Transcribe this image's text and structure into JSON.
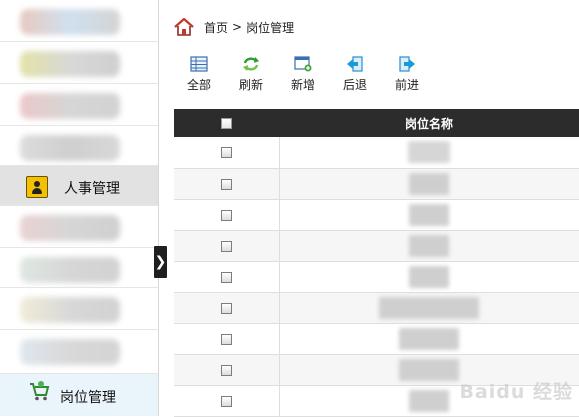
{
  "sidebar": {
    "items": [
      {
        "id": "blurred-1",
        "label": ""
      },
      {
        "id": "blurred-2",
        "label": ""
      },
      {
        "id": "blurred-3",
        "label": ""
      },
      {
        "id": "blurred-4",
        "label": ""
      },
      {
        "id": "hr",
        "label": "人事管理"
      },
      {
        "id": "blurred-5",
        "label": ""
      },
      {
        "id": "blurred-6",
        "label": ""
      },
      {
        "id": "blurred-7",
        "label": ""
      },
      {
        "id": "blurred-8",
        "label": ""
      },
      {
        "id": "position",
        "label": "岗位管理"
      }
    ],
    "toggle_glyph": "❯",
    "active_color": "#e2e2e2",
    "selected_color": "#eaf4fb"
  },
  "breadcrumb": {
    "home": "首页",
    "separator": ">",
    "current": "岗位管理"
  },
  "toolbar": {
    "buttons": [
      {
        "id": "all",
        "label": "全部",
        "icon": "grid-list-icon"
      },
      {
        "id": "refresh",
        "label": "刷新",
        "icon": "refresh-icon"
      },
      {
        "id": "add",
        "label": "新增",
        "icon": "add-window-icon"
      },
      {
        "id": "back",
        "label": "后退",
        "icon": "back-arrow-icon"
      },
      {
        "id": "forward",
        "label": "前进",
        "icon": "forward-arrow-icon"
      }
    ]
  },
  "grid": {
    "header": {
      "name_column": "岗位名称"
    },
    "header_color": "#2c2c2c",
    "rows": [
      {
        "name": ""
      },
      {
        "name": ""
      },
      {
        "name": ""
      },
      {
        "name": ""
      },
      {
        "name": ""
      },
      {
        "name": ""
      },
      {
        "name": ""
      },
      {
        "name": ""
      },
      {
        "name": ""
      }
    ]
  },
  "watermark": "Baidu 经验"
}
